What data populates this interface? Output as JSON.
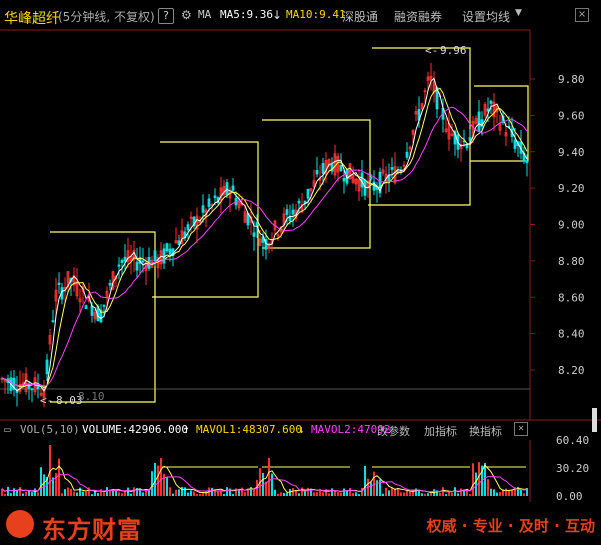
{
  "header": {
    "stock_name": "华峰超纤",
    "period": "(5分钟线, 不复权)",
    "help": "?",
    "gear": "⚙",
    "ma_label": "MA",
    "ma5": "MA5:9.36",
    "arrow_down": "↓",
    "ma10": "MA10:9.41",
    "tab_shenzhen": "深股通",
    "tab_margin": "融资融券",
    "tab_settings": "设置均线",
    "caret": "▼",
    "close": "×"
  },
  "price_axis": [
    "9.80",
    "9.60",
    "9.40",
    "9.20",
    "9.00",
    "8.80",
    "8.60",
    "8.40",
    "8.20"
  ],
  "annotations": {
    "high": "9.96",
    "low": "8.03",
    "low_ref": "8.10"
  },
  "volume_header": {
    "title": "VOL(5,10)",
    "volume": "VOLUME:42906.000",
    "arrow_up": "↑",
    "mavol1": "MAVOL1:48307.600",
    "arrow_down": "↓",
    "mavol2": "MAVOL2:47092",
    "btn_params": "改参数",
    "btn_add": "加指标",
    "btn_switch": "换指标",
    "close": "×"
  },
  "volume_axis": [
    "60.40",
    "30.20",
    "0.00"
  ],
  "banner": {
    "brand": "东方财富",
    "slogan": "权威 · 专业 · 及时 · 互动"
  },
  "colors": {
    "up": "#ff3030",
    "down": "#00e0e0",
    "ma_yellow": "#ffff66",
    "ma_white": "#ffffff",
    "ma_magenta": "#ff40ff",
    "brand": "#e8401c"
  }
}
